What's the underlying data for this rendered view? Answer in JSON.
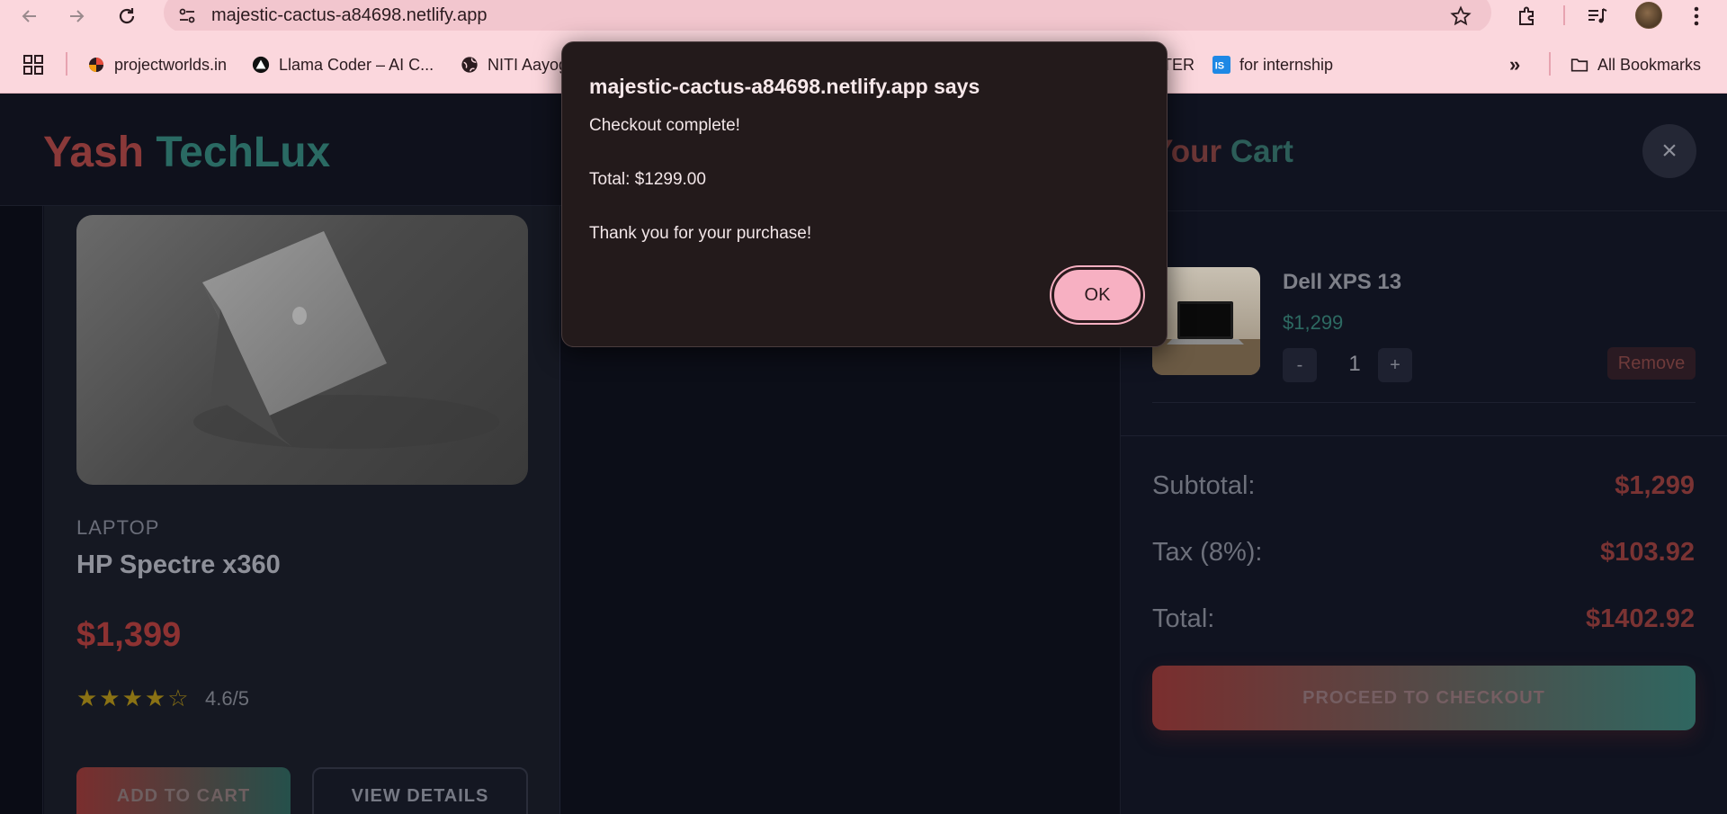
{
  "browser": {
    "url": "majestic-cactus-a84698.netlify.app",
    "bookmarks": [
      {
        "label": "projectworlds.in",
        "icon": "projectworlds-icon"
      },
      {
        "label": "Llama Coder – AI C...",
        "icon": "triangle-logo-icon"
      },
      {
        "label": "NITI Aayog",
        "icon": "globe-icon"
      },
      {
        "label": "TER",
        "icon": ""
      },
      {
        "label": "for internship",
        "icon": "internshala-icon"
      }
    ],
    "bookmarks_overflow": "»",
    "all_bookmarks": "All Bookmarks"
  },
  "site": {
    "logo_part1": "Yash",
    "logo_part2": "TechLux"
  },
  "product": {
    "category": "LAPTOP",
    "name": "HP Spectre x360",
    "price": "$1,399",
    "stars": "★★★★☆",
    "rating": "4.6/5",
    "add_to_cart": "ADD TO CART",
    "view_details": "VIEW DETAILS"
  },
  "cart": {
    "title_part1": "Your",
    "title_part2": "Cart",
    "close": "×",
    "item": {
      "name": "Dell XPS 13",
      "price": "$1,299",
      "minus": "-",
      "qty": "1",
      "plus": "+",
      "remove": "Remove"
    },
    "subtotal_label": "Subtotal:",
    "subtotal": "$1,299",
    "tax_label": "Tax (8%):",
    "tax": "$103.92",
    "total_label": "Total:",
    "total": "$1402.92",
    "checkout": "PROCEED TO CHECKOUT"
  },
  "dialog": {
    "title": "majestic-cactus-a84698.netlify.app says",
    "line1": "Checkout complete!",
    "line2": "Total: $1299.00",
    "line3": "Thank you for your purchase!",
    "ok": "OK"
  }
}
